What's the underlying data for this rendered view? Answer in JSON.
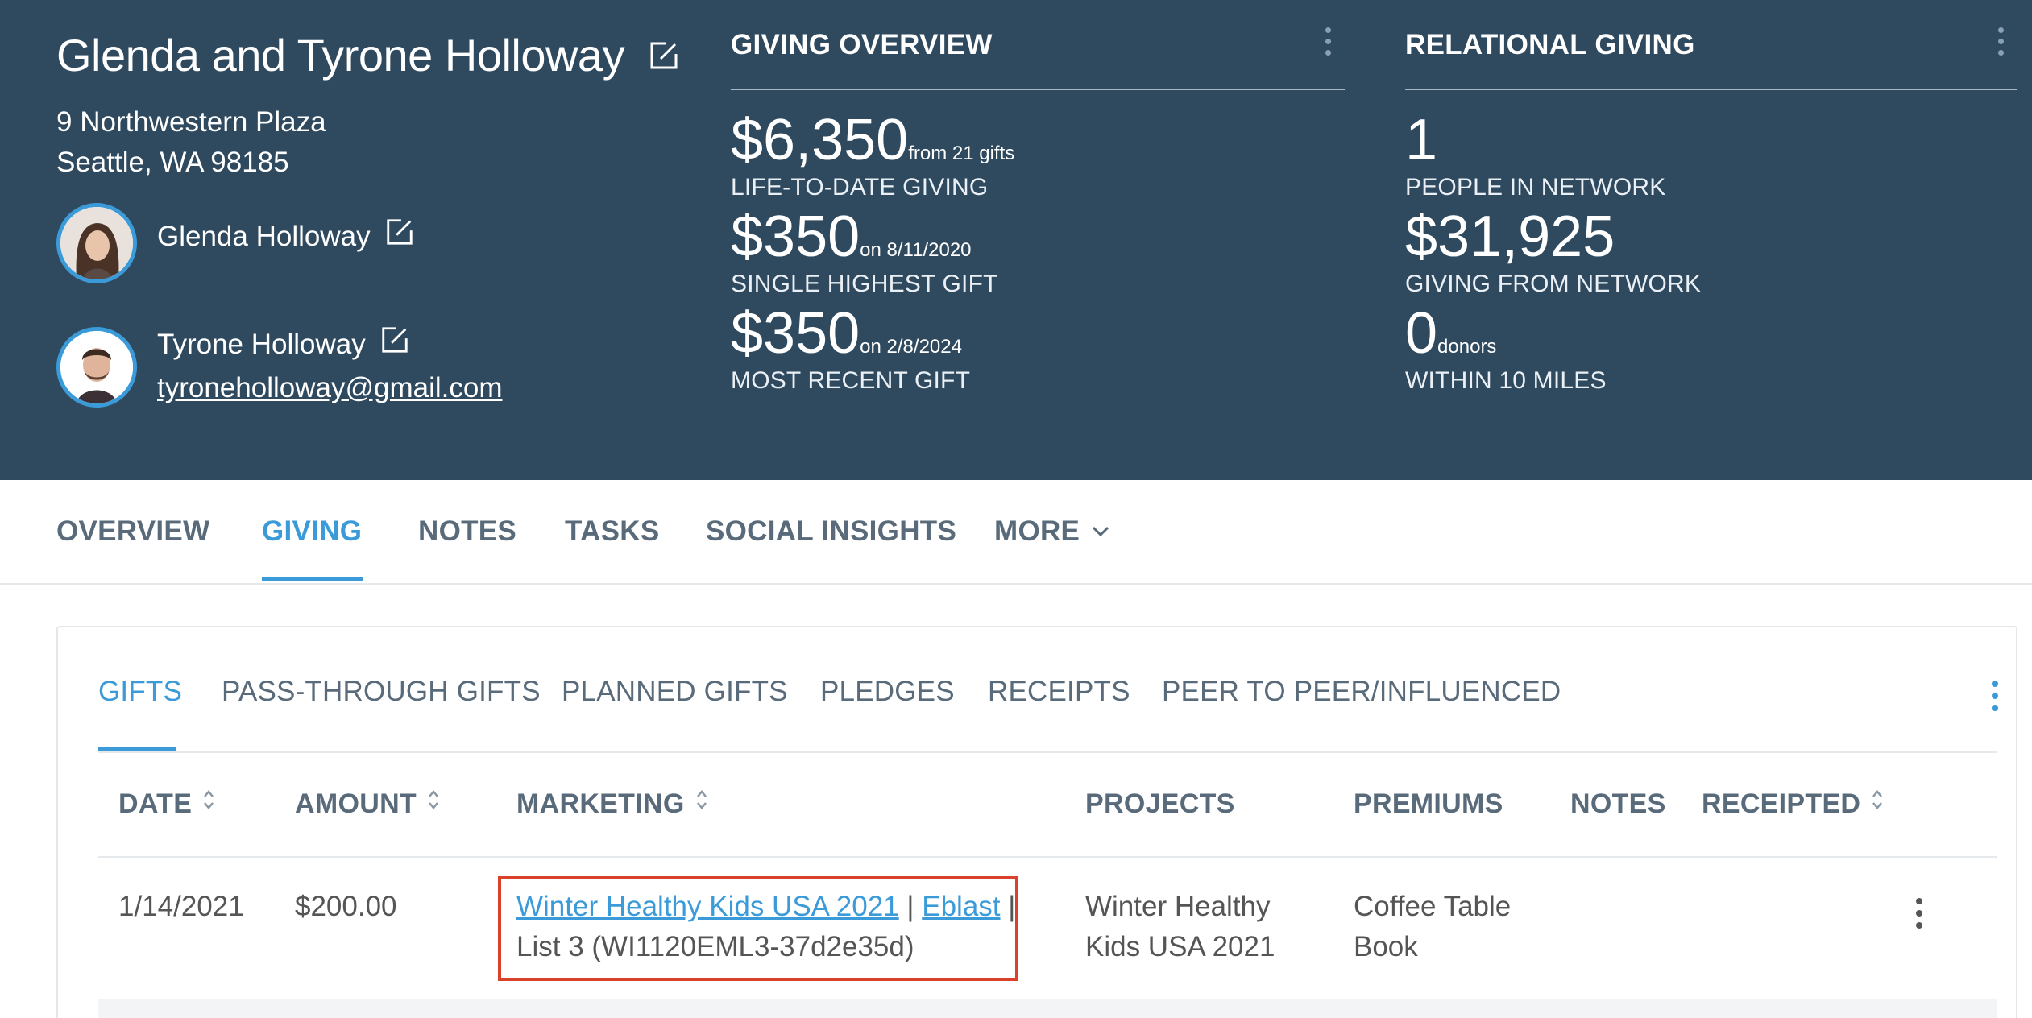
{
  "donor": {
    "name": "Glenda and Tyrone Holloway",
    "address_line1": "9 Northwestern Plaza",
    "address_line2": "Seattle, WA 98185",
    "members": [
      {
        "name": "Glenda Holloway",
        "email": ""
      },
      {
        "name": "Tyrone Holloway",
        "email": "tyroneholloway@gmail.com"
      }
    ]
  },
  "giving_overview": {
    "title": "GIVING OVERVIEW",
    "life_to_date": {
      "value": "$6,350",
      "detail": "from 21 gifts",
      "label": "LIFE-TO-DATE GIVING"
    },
    "highest_gift": {
      "value": "$350",
      "detail": "on 8/11/2020",
      "label": "SINGLE HIGHEST GIFT"
    },
    "recent_gift": {
      "value": "$350",
      "detail": "on 2/8/2024",
      "label": "MOST RECENT GIFT"
    }
  },
  "relational_giving": {
    "title": "RELATIONAL GIVING",
    "people": {
      "value": "1",
      "label": "PEOPLE IN NETWORK"
    },
    "network_giving": {
      "value": "$31,925",
      "label": "GIVING FROM NETWORK"
    },
    "nearby": {
      "value": "0",
      "detail": "donors",
      "label": "WITHIN 10 MILES"
    }
  },
  "main_tabs": [
    {
      "label": "OVERVIEW"
    },
    {
      "label": "GIVING"
    },
    {
      "label": "NOTES"
    },
    {
      "label": "TASKS"
    },
    {
      "label": "SOCIAL INSIGHTS"
    },
    {
      "label": "MORE"
    }
  ],
  "active_main_tab": "GIVING",
  "sub_tabs": [
    {
      "label": "GIFTS"
    },
    {
      "label": "PASS-THROUGH GIFTS"
    },
    {
      "label": "PLANNED GIFTS"
    },
    {
      "label": "PLEDGES"
    },
    {
      "label": "RECEIPTS"
    },
    {
      "label": "PEER TO PEER/INFLUENCED"
    }
  ],
  "active_sub_tab": "GIFTS",
  "table": {
    "columns": [
      "DATE",
      "AMOUNT",
      "MARKETING",
      "PROJECTS",
      "PREMIUMS",
      "NOTES",
      "RECEIPTED"
    ],
    "rows": [
      {
        "date": "1/14/2021",
        "amount": "$200.00",
        "marketing_campaign": "Winter Healthy Kids USA 2021",
        "marketing_separator": "|",
        "marketing_channel": "Eblast",
        "marketing_list": "List 3 (WI1120EML3-37d2e35d)",
        "projects_line1": "Winter Healthy",
        "projects_line2": "Kids USA 2021",
        "premiums_line1": "Coffee Table",
        "premiums_line2": "Book",
        "notes": "",
        "receipted": ""
      }
    ]
  },
  "colors": {
    "header_bg": "#2f4a5f",
    "accent": "#3b9bd9",
    "highlight_border": "#d9412b"
  }
}
